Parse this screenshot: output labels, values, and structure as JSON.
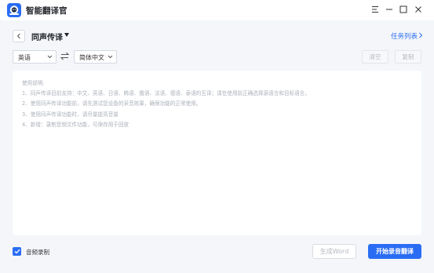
{
  "window": {
    "app_title": "智能翻译官",
    "controls": [
      "menu-icon",
      "minimize-icon",
      "maximize-icon",
      "close-icon"
    ]
  },
  "header": {
    "mode_title": "同声传译",
    "task_list_label": "任务列表"
  },
  "toolbar": {
    "source_language": "英语",
    "target_language": "简体中文",
    "clear_label": "清空",
    "copy_label": "复制"
  },
  "instructions": {
    "heading": "使用说明:",
    "lines": [
      "1、同声传译目前支持：中文、英语、日语、韩语、俄语、法语、德语、泰语的互译；请在使用前正确选择源语言和目标语言。",
      "2、使用同声传译功能前，请先测试您设备的采音效果，确保功能的正常使用。",
      "3、使用同声传译功能时，请尽量提高音量",
      "4、新增：录制音频文件功能，可保存用于回放"
    ]
  },
  "footer": {
    "record_audio_label": "音频录制",
    "record_audio_checked": true,
    "generate_word_label": "生成Word",
    "start_label": "开始录音翻译"
  },
  "colors": {
    "accent": "#2a6df4",
    "background": "#f4f6fa",
    "panel": "#ffffff",
    "muted_text": "#aab0ba"
  }
}
